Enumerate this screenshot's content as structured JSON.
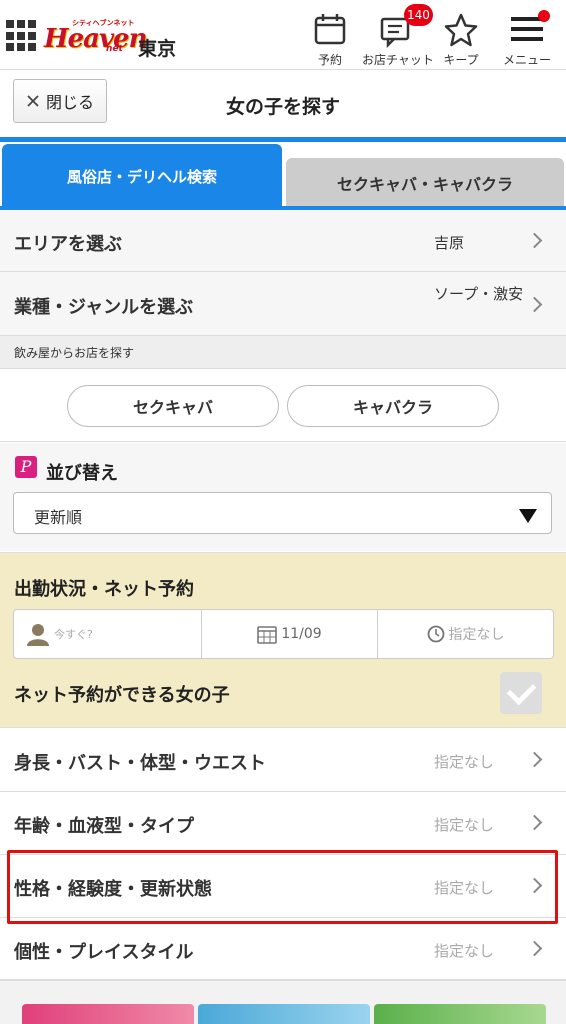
{
  "header": {
    "logo_small_text": "シティヘブンネット",
    "logo_text": "Heaven",
    "logo_net": "net",
    "region": "東京",
    "buttons": {
      "reserve": "予約",
      "chat": "お店チャット",
      "chat_badge": "140",
      "keep": "キープ",
      "menu": "メニュー"
    }
  },
  "titlebar": {
    "close_label": "閉じる",
    "title": "女の子を探す"
  },
  "tabs": {
    "active": "風俗店・デリヘル検索",
    "inactive": "セクキャバ・キャバクラ"
  },
  "filters": {
    "area": {
      "label": "エリアを選ぶ",
      "value": "吉原"
    },
    "genre": {
      "label": "業種・ジャンルを選ぶ",
      "value": "ソープ・激安"
    }
  },
  "bar_section": {
    "title": "飲み屋からお店を探す",
    "buttons": [
      "セクキャバ",
      "キャバクラ"
    ]
  },
  "sort": {
    "title": "並び替え",
    "selected": "更新順",
    "icon_letter": "P"
  },
  "attendance": {
    "title": "出勤状況・ネット予約",
    "now_placeholder": "今すぐ?",
    "date": "11/09",
    "time": "指定なし",
    "net_reserve_label": "ネット予約ができる女の子"
  },
  "detail_rows": [
    {
      "label": "身長・バスト・体型・ウエスト",
      "value": "指定なし"
    },
    {
      "label": "年齢・血液型・タイプ",
      "value": "指定なし"
    },
    {
      "label": "性格・経験度・更新状態",
      "value": "指定なし"
    },
    {
      "label": "個性・プレイスタイル",
      "value": "指定なし"
    }
  ],
  "colors": {
    "accent_blue": "#1a86e8",
    "highlight_red": "#e01010",
    "badge_red": "#e60012",
    "attendance_bg": "#f2ebc6"
  }
}
